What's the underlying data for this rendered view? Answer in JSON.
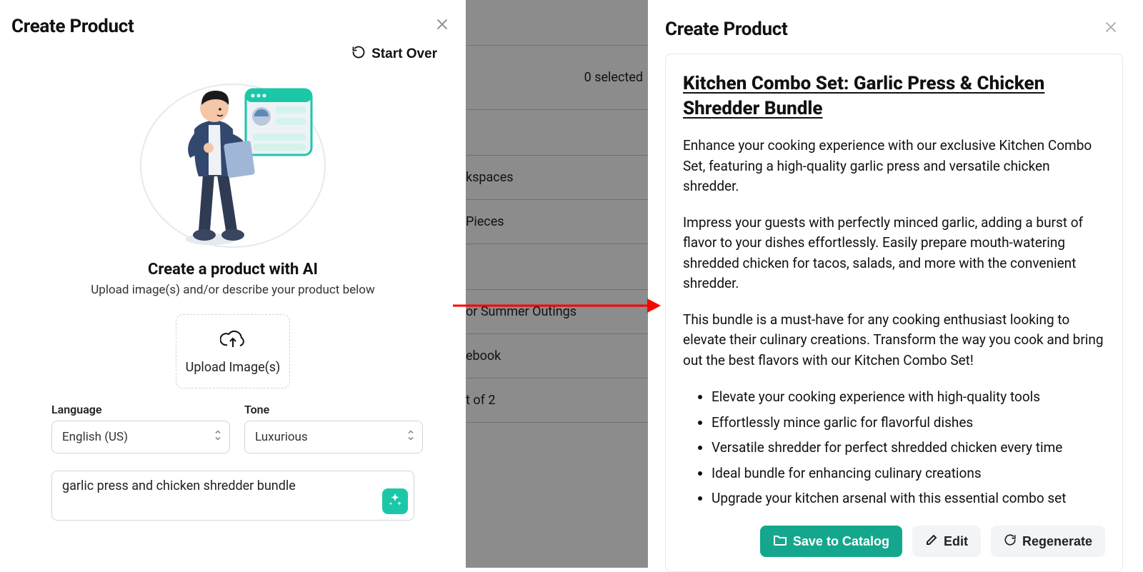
{
  "left": {
    "title": "Create Product",
    "start_over": "Start Over",
    "ai_title": "Create a product with AI",
    "ai_sub": "Upload image(s) and/or describe your product below",
    "upload_label": "Upload Image(s)",
    "language_label": "Language",
    "language_value": "English (US)",
    "tone_label": "Tone",
    "tone_value": "Luxurious",
    "prompt_value": "garlic press and chicken shredder bundle"
  },
  "right": {
    "title": "Create Product",
    "product_title": "Kitchen Combo Set: Garlic Press & Chicken Shredder Bundle",
    "paragraphs": [
      "Enhance your cooking experience with our exclusive Kitchen Combo Set, featuring a high-quality garlic press and versatile chicken shredder.",
      "Impress your guests with perfectly minced garlic, adding a burst of flavor to your dishes effortlessly. Easily prepare mouth-watering shredded chicken for tacos, salads, and more with the convenient shredder.",
      "This bundle is a must-have for any cooking enthusiast looking to elevate their culinary creations. Transform the way you cook and bring out the best flavors with our Kitchen Combo Set!"
    ],
    "bullets": [
      "Elevate your cooking experience with high-quality tools",
      "Effortlessly mince garlic for flavorful dishes",
      "Versatile shredder for perfect shredded chicken every time",
      "Ideal bundle for enhancing culinary creations",
      "Upgrade your kitchen arsenal with this essential combo set"
    ],
    "save_label": "Save to Catalog",
    "edit_label": "Edit",
    "regenerate_label": "Regenerate"
  },
  "background": {
    "selected_text": "0 selected",
    "rows": [
      "kspaces",
      "Pieces",
      "or Summer Outings",
      "ebook",
      "t of 2"
    ]
  }
}
